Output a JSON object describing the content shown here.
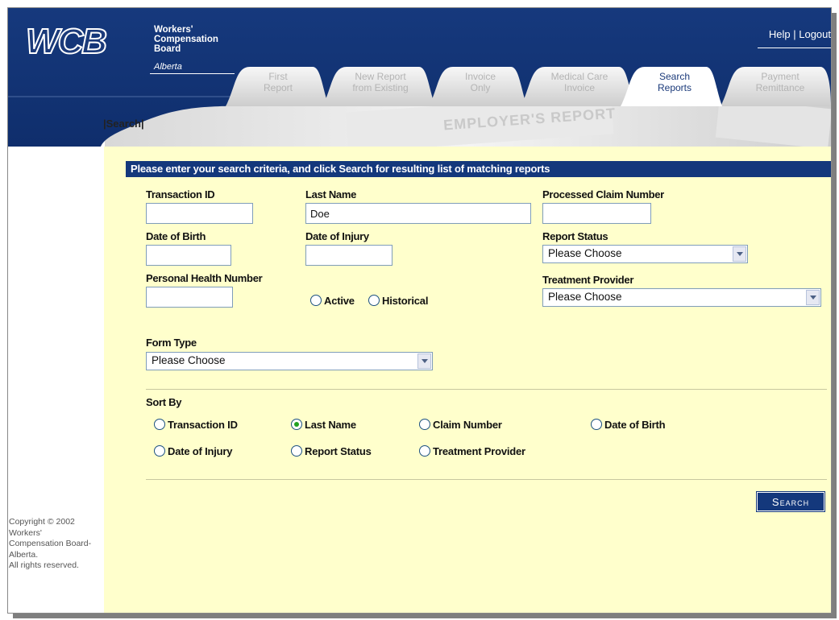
{
  "header": {
    "logo_text": "WCB",
    "board_name_lines": [
      "Workers'",
      "Compensation",
      "Board"
    ],
    "province": "Alberta",
    "help_link": "Help",
    "link_separator": "|",
    "logout_link": "Logout",
    "colors": {
      "navy": "#14387c",
      "yellow_bg": "#ffffcc"
    }
  },
  "tabs": [
    {
      "line1": "First",
      "line2": "Report",
      "active": false
    },
    {
      "line1": "New Report",
      "line2": "from Existing",
      "active": false
    },
    {
      "line1": "Invoice",
      "line2": "Only",
      "active": false
    },
    {
      "line1": "Medical Care",
      "line2": "Invoice",
      "active": false
    },
    {
      "line1": "Search",
      "line2": "Reports",
      "active": true
    },
    {
      "line1": "Payment",
      "line2": "Remittance",
      "active": false
    }
  ],
  "breadcrumb": "|Search|",
  "banner_text": "EMPLOYER'S REPORT",
  "instructions": "Please enter your search criteria, and click Search for resulting list of matching reports",
  "form": {
    "transaction_id_label": "Transaction ID",
    "transaction_id_value": "",
    "last_name_label": "Last Name",
    "last_name_value": "Doe",
    "claim_number_label": "Processed Claim Number",
    "claim_number_value": "",
    "dob_label": "Date of Birth",
    "dob_value": "",
    "doi_label": "Date of Injury",
    "doi_value": "",
    "report_status_label": "Report Status",
    "report_status_value": "Please Choose",
    "phn_label": "Personal Health Number",
    "phn_value": "",
    "active_label": "Active",
    "historical_label": "Historical",
    "treatment_provider_label": "Treatment Provider",
    "treatment_provider_value": "Please Choose",
    "form_type_label": "Form Type",
    "form_type_value": "Please Choose"
  },
  "sort": {
    "label": "Sort By",
    "options": [
      {
        "label": "Transaction ID",
        "selected": false
      },
      {
        "label": "Last Name",
        "selected": true
      },
      {
        "label": "Claim Number",
        "selected": false
      },
      {
        "label": "Date of Birth",
        "selected": false
      },
      {
        "label": "Date of Injury",
        "selected": false
      },
      {
        "label": "Report Status",
        "selected": false
      },
      {
        "label": "Treatment Provider",
        "selected": false
      }
    ]
  },
  "search_button": "Search",
  "copyright": [
    "Copyright © 2002",
    "Workers'",
    "Compensation Board-",
    "Alberta.",
    "All rights reserved."
  ]
}
